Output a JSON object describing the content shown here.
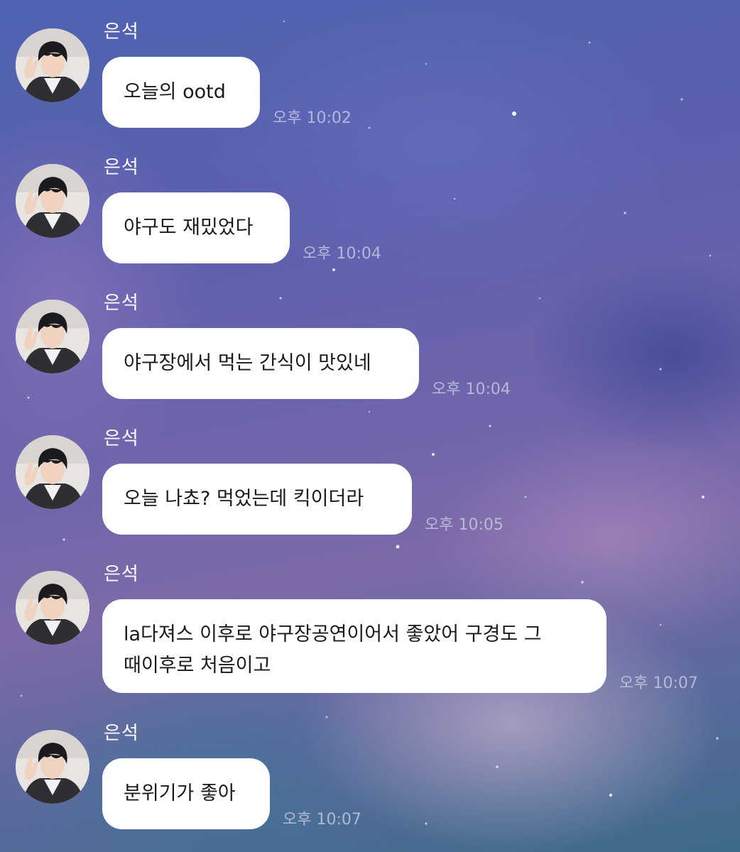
{
  "chat": {
    "messages": [
      {
        "sender": "은석",
        "text": "오늘의 ootd",
        "time": "오후 10:02"
      },
      {
        "sender": "은석",
        "text": "야구도 재밌었다",
        "time": "오후 10:04"
      },
      {
        "sender": "은석",
        "text": "야구장에서 먹는 간식이 맛있네",
        "time": "오후 10:04"
      },
      {
        "sender": "은석",
        "text": "오늘 나쵸? 먹었는데 킥이더라",
        "time": "오후 10:05"
      },
      {
        "sender": "은석",
        "text": "la다져스 이후로 야구장공연이어서 좋았어 구경도 그\n때이후로 처음이고",
        "time": "오후 10:07"
      },
      {
        "sender": "은석",
        "text": "분위기가 좋아",
        "time": "오후 10:07"
      }
    ]
  },
  "colors": {
    "bubble": "#ffffff",
    "text": "#1a1a1a",
    "sender": "#ffffff",
    "timestamp": "#c8cde1"
  },
  "icons": {
    "avatar": "profile-photo"
  }
}
